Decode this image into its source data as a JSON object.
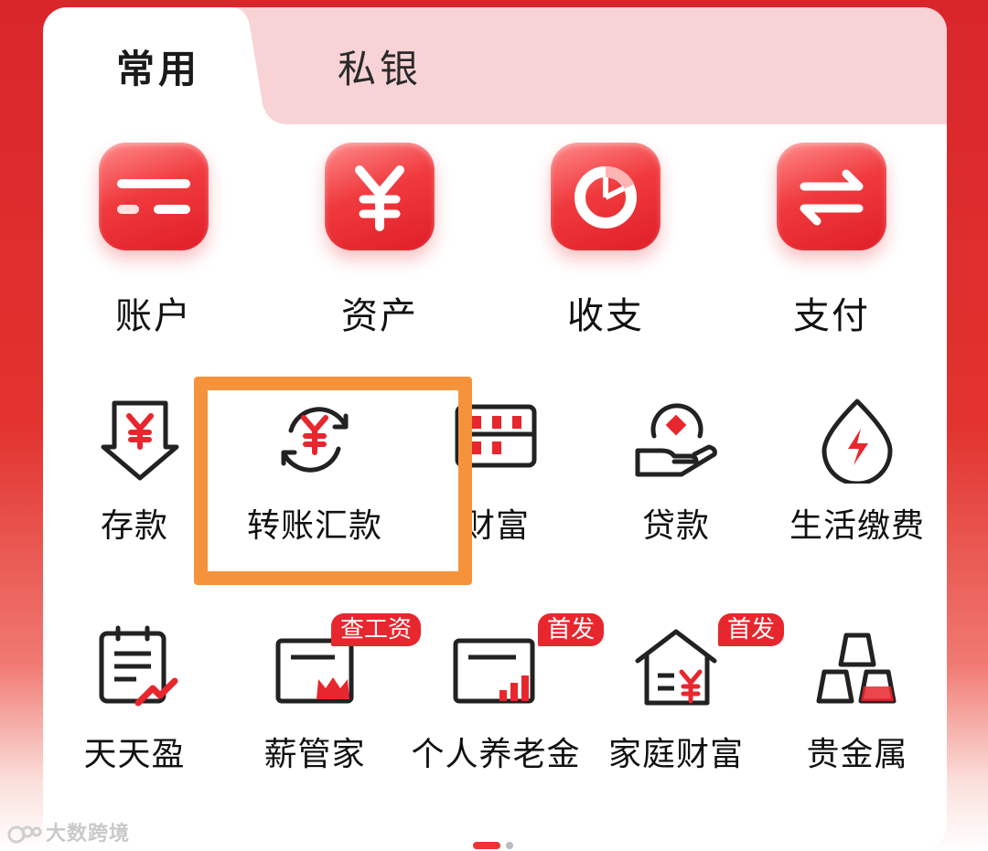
{
  "tabs": [
    {
      "label": "常用",
      "active": true
    },
    {
      "label": "私银",
      "active": false
    }
  ],
  "primary_items": [
    {
      "label": "账户",
      "icon": "account-card-icon"
    },
    {
      "label": "资产",
      "icon": "yuan-icon"
    },
    {
      "label": "收支",
      "icon": "pie-chart-icon"
    },
    {
      "label": "支付",
      "icon": "exchange-arrows-icon"
    }
  ],
  "service_items": [
    {
      "label": "存款",
      "icon": "deposit-icon"
    },
    {
      "label": "转账汇款",
      "icon": "transfer-icon"
    },
    {
      "label": "财富",
      "icon": "abacus-icon"
    },
    {
      "label": "贷款",
      "icon": "loan-hand-icon"
    },
    {
      "label": "生活缴费",
      "icon": "utility-drop-icon"
    }
  ],
  "featured_items": [
    {
      "label": "天天盈",
      "icon": "calendar-growth-icon",
      "badge": ""
    },
    {
      "label": "薪管家",
      "icon": "salary-crown-icon",
      "badge": "查工资"
    },
    {
      "label": "个人养老金",
      "icon": "pension-chart-icon",
      "badge": "首发"
    },
    {
      "label": "家庭财富",
      "icon": "family-house-icon",
      "badge": "首发"
    },
    {
      "label": "贵金属",
      "icon": "gold-bars-icon",
      "badge": ""
    }
  ],
  "watermark": "大数跨境",
  "colors": {
    "brand_red": "#e8262d",
    "highlight_orange": "#f5923c",
    "tab_inactive_bg": "#f8d3d5"
  },
  "pager": {
    "pages": 2,
    "active": 1
  }
}
